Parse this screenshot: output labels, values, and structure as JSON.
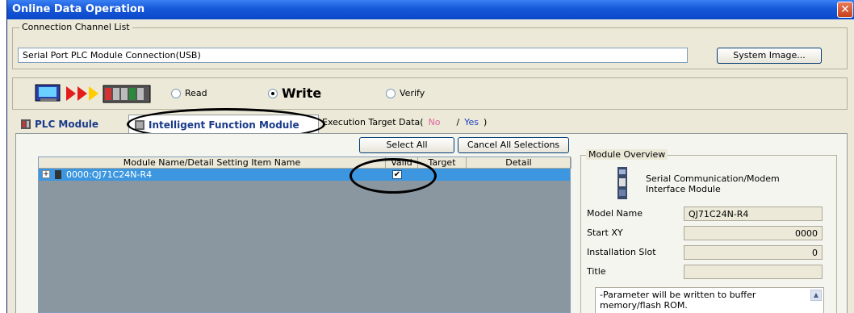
{
  "window": {
    "title": "Online Data Operation",
    "close_symbol": "✕"
  },
  "connection": {
    "legend": "Connection Channel List",
    "value": "Serial Port  PLC Module Connection(USB)",
    "system_image_button": "System Image..."
  },
  "mode": {
    "read": "Read",
    "write": "Write",
    "verify": "Verify",
    "selected": "Write"
  },
  "tabs": {
    "plc_module": "PLC Module",
    "intelligent": "Intelligent Function Module",
    "exec_target_prefix": "Execution Target Data(",
    "exec_no": "No",
    "exec_sep": "/",
    "exec_yes": "Yes",
    "exec_suffix": ")"
  },
  "toolbar": {
    "select_all": "Select All",
    "cancel_all": "Cancel All Selections"
  },
  "grid": {
    "columns": [
      "Module Name/Detail Setting Item Name",
      "Valid",
      "Target",
      "Detail"
    ],
    "rows": [
      {
        "expander": "+",
        "name": "0000:QJ71C24N-R4",
        "valid": "✔"
      }
    ]
  },
  "overview": {
    "legend": "Module Overview",
    "description": "Serial Communication/Modem Interface Module",
    "model_name_label": "Model Name",
    "model_name_value": "QJ71C24N-R4",
    "start_xy_label": "Start XY",
    "start_xy_value": "0000",
    "slot_label": "Installation Slot",
    "slot_value": "0",
    "title_label": "Title",
    "title_value": "",
    "note": "-Parameter will be written to buffer memory/flash ROM."
  },
  "colors": {
    "titlebar": "#0a48c8",
    "selection": "#3d97e0",
    "grid_bg": "#8a96a0"
  }
}
